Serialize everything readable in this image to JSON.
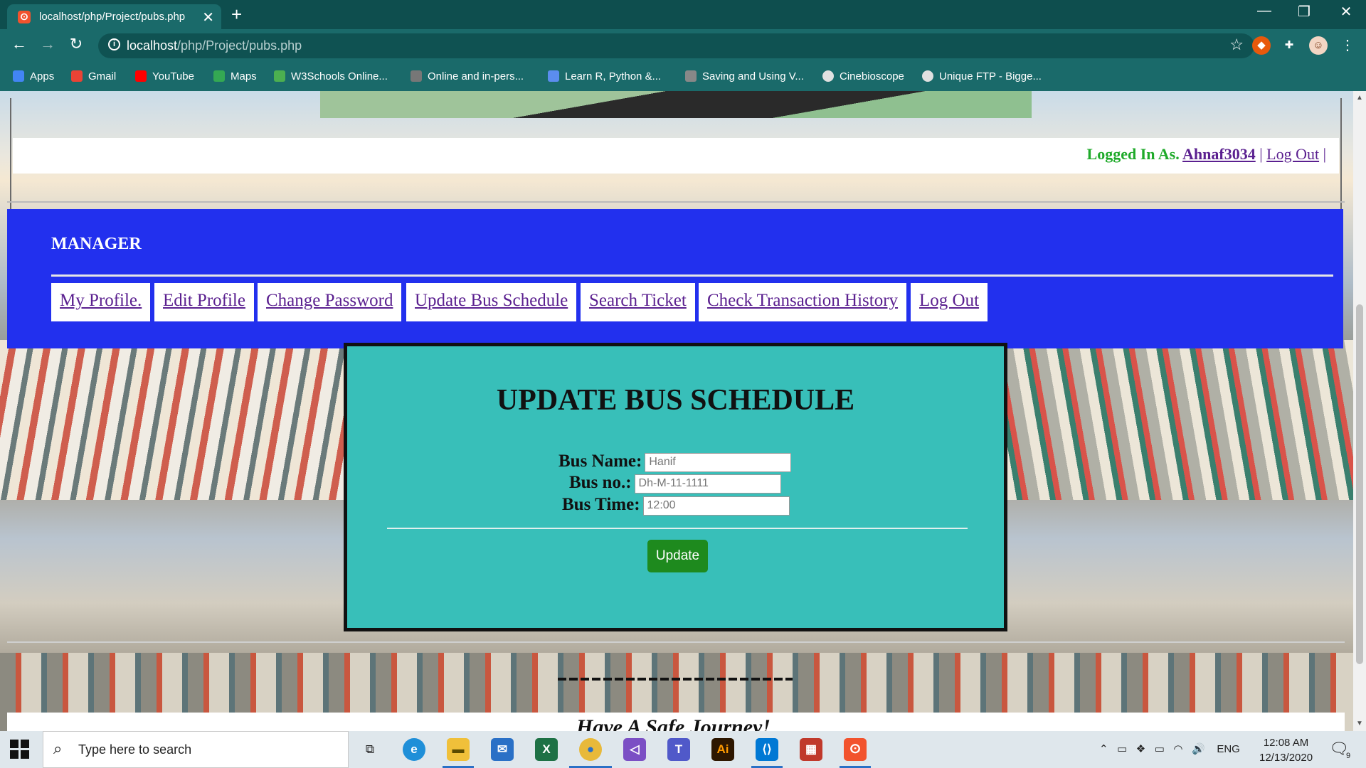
{
  "browser": {
    "tab_title": "localhost/php/Project/pubs.php",
    "tab_close": "✕",
    "new_tab": "+",
    "url_host": "localhost",
    "url_path": "/php/Project/pubs.php",
    "bookmarks": [
      {
        "label": "Apps",
        "color": "#4285f4"
      },
      {
        "label": "Gmail",
        "color": "#ea4335"
      },
      {
        "label": "YouTube",
        "color": "#ff0000"
      },
      {
        "label": "Maps",
        "color": "#34a853"
      },
      {
        "label": "W3Schools Online...",
        "color": "#4caf50"
      },
      {
        "label": "Online and in-pers...",
        "color": "#777777"
      },
      {
        "label": "Learn R, Python &...",
        "color": "#5b8def"
      },
      {
        "label": "Saving and Using V...",
        "color": "#888888"
      },
      {
        "label": "Cinebioscope",
        "color": "#e0e0e0"
      },
      {
        "label": "Unique FTP - Bigge...",
        "color": "#e0e0e0"
      }
    ]
  },
  "page": {
    "logged_in_label": "Logged In As.",
    "username": "Ahnaf3034",
    "logout_label": "Log Out",
    "role_heading": "MANAGER",
    "nav": [
      "My Profile.",
      "Edit Profile",
      "Change Password",
      "Update Bus Schedule",
      "Search Ticket",
      "Check Transaction History",
      "Log Out"
    ],
    "form_title": "UPDATE BUS SCHEDULE",
    "fields": {
      "bus_name": {
        "label": "Bus Name:",
        "placeholder": "Hanif"
      },
      "bus_no": {
        "label": "Bus no.:",
        "placeholder": "Dh-M-11-1111"
      },
      "bus_time": {
        "label": "Bus Time:",
        "placeholder": "12:00"
      }
    },
    "update_button": "Update",
    "footer_text": "Have A Safe Journey!"
  },
  "taskbar": {
    "search_placeholder": "Type here to search",
    "language": "ENG",
    "time": "12:08 AM",
    "date": "12/13/2020",
    "notification_count": "9"
  }
}
